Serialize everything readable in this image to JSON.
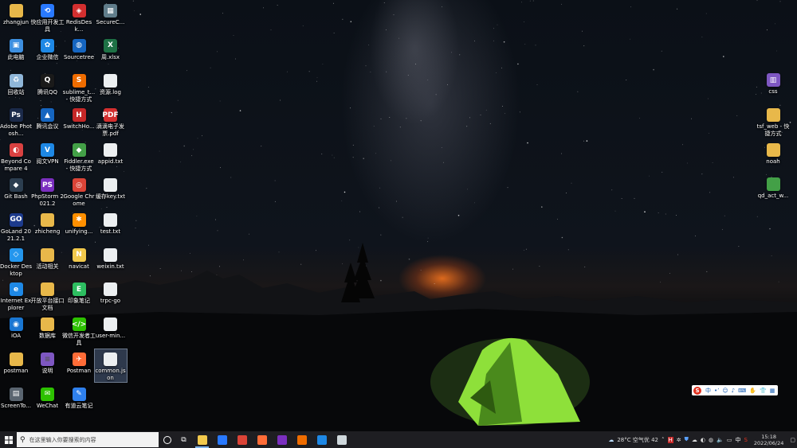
{
  "desktop_icons": [
    {
      "label": "zhangjun",
      "icon": "folder-icon",
      "color": "#e8b84a",
      "glyph": ""
    },
    {
      "label": "此电脑",
      "icon": "computer-icon",
      "color": "#3d8fe0",
      "glyph": "▣"
    },
    {
      "label": "回收站",
      "icon": "recycle-bin-icon",
      "color": "#8fb6d8",
      "glyph": "♻"
    },
    {
      "label": "Adobe Photosh...",
      "icon": "photoshop-icon",
      "color": "#1b2a4a",
      "glyph": "Ps"
    },
    {
      "label": "Beyond Compare 4",
      "icon": "beyond-compare-icon",
      "color": "#d94141",
      "glyph": "◐"
    },
    {
      "label": "Git Bash",
      "icon": "git-bash-icon",
      "color": "#2c3e50",
      "glyph": "◆"
    },
    {
      "label": "GoLand 2021.2.1",
      "icon": "goland-icon",
      "color": "#1c3a8c",
      "glyph": "GO"
    },
    {
      "label": "Docker Desktop",
      "icon": "docker-icon",
      "color": "#2496ed",
      "glyph": "◇"
    },
    {
      "label": "Internet Explorer",
      "icon": "internet-explorer-icon",
      "color": "#1e88e5",
      "glyph": "e"
    },
    {
      "label": "iOA",
      "icon": "ioa-icon",
      "color": "#1976d2",
      "glyph": "◉"
    },
    {
      "label": "postman",
      "icon": "folder-icon",
      "color": "#e8b84a",
      "glyph": ""
    },
    {
      "label": "ScreenTo...",
      "icon": "screen-to-gif-icon",
      "color": "#5a6570",
      "glyph": "▤"
    },
    {
      "label": "快应用开发工具",
      "icon": "quickapp-icon",
      "color": "#2979ff",
      "glyph": "⟲"
    },
    {
      "label": "企业微信",
      "icon": "wecom-icon",
      "color": "#1e88e5",
      "glyph": "✿"
    },
    {
      "label": "腾讯QQ",
      "icon": "qq-icon",
      "color": "#1a1a1a",
      "glyph": "Q"
    },
    {
      "label": "腾讯会议",
      "icon": "tencent-meeting-icon",
      "color": "#1565c0",
      "glyph": "▲"
    },
    {
      "label": "阅文VPN",
      "icon": "vpn-icon",
      "color": "#1e88e5",
      "glyph": "V"
    },
    {
      "label": "PhpStorm 2021.2",
      "icon": "phpstorm-icon",
      "color": "#7b2fbf",
      "glyph": "PS"
    },
    {
      "label": "zhicheng",
      "icon": "folder-icon",
      "color": "#e8b84a",
      "glyph": ""
    },
    {
      "label": "活动相关",
      "icon": "folder-icon",
      "color": "#e8b84a",
      "glyph": ""
    },
    {
      "label": "开放平台接口文档",
      "icon": "folder-icon",
      "color": "#e8b84a",
      "glyph": ""
    },
    {
      "label": "数据库",
      "icon": "folder-icon",
      "color": "#e8b84a",
      "glyph": ""
    },
    {
      "label": "说明",
      "icon": "text-file-icon",
      "color": "#7e57c2",
      "glyph": "≡"
    },
    {
      "label": "WeChat",
      "icon": "wechat-icon",
      "color": "#2dc100",
      "glyph": "✉"
    },
    {
      "label": "RedisDesk...",
      "icon": "redis-icon",
      "color": "#d32f2f",
      "glyph": "◈"
    },
    {
      "label": "Sourcetree",
      "icon": "sourcetree-icon",
      "color": "#1565c0",
      "glyph": "◍"
    },
    {
      "label": "sublime_t... - 快捷方式",
      "icon": "sublime-icon",
      "color": "#ef6c00",
      "glyph": "S"
    },
    {
      "label": "SwitchHo...",
      "icon": "switchhosts-icon",
      "color": "#c62828",
      "glyph": "H"
    },
    {
      "label": "Fiddler.exe - 快捷方式",
      "icon": "fiddler-icon",
      "color": "#43a047",
      "glyph": "◆"
    },
    {
      "label": "Google Chrome",
      "icon": "chrome-icon",
      "color": "#db4437",
      "glyph": "◎"
    },
    {
      "label": "unifying...",
      "icon": "unifying-icon",
      "color": "#ff8f00",
      "glyph": "✱"
    },
    {
      "label": "navicat",
      "icon": "navicat-icon",
      "color": "#f2c94c",
      "glyph": "N"
    },
    {
      "label": "印象笔记",
      "icon": "evernote-icon",
      "color": "#2dbe60",
      "glyph": "E"
    },
    {
      "label": "微信开发者工具",
      "icon": "wechat-devtools-icon",
      "color": "#2dc100",
      "glyph": "</>"
    },
    {
      "label": "Postman",
      "icon": "postman-icon",
      "color": "#ff6c37",
      "glyph": "✈"
    },
    {
      "label": "有道云笔记",
      "icon": "youdao-note-icon",
      "color": "#2f80ed",
      "glyph": "✎"
    },
    {
      "label": "SecureC...",
      "icon": "securecrt-icon",
      "color": "#607d8b",
      "glyph": "▦"
    },
    {
      "label": "周.xlsx",
      "icon": "excel-icon",
      "color": "#1e7145",
      "glyph": "X"
    },
    {
      "label": "资源.log",
      "icon": "text-file-icon",
      "color": "#eceff1",
      "glyph": ""
    },
    {
      "label": "滴滴电子发票.pdf",
      "icon": "pdf-icon",
      "color": "#d32f2f",
      "glyph": "PDF"
    },
    {
      "label": "appid.txt",
      "icon": "text-file-icon",
      "color": "#eceff1",
      "glyph": ""
    },
    {
      "label": "缓存key.txt",
      "icon": "text-file-icon",
      "color": "#eceff1",
      "glyph": ""
    },
    {
      "label": "test.txt",
      "icon": "text-file-icon",
      "color": "#eceff1",
      "glyph": ""
    },
    {
      "label": "weixin.txt",
      "icon": "text-file-icon",
      "color": "#eceff1",
      "glyph": ""
    },
    {
      "label": "trpc-go",
      "icon": "file-icon",
      "color": "#eceff1",
      "glyph": ""
    },
    {
      "label": "user-min...",
      "icon": "file-icon",
      "color": "#eceff1",
      "glyph": ""
    },
    {
      "label": "common.json",
      "icon": "file-icon",
      "color": "#eceff1",
      "glyph": ""
    }
  ],
  "right_icons": [
    {
      "label": "css",
      "icon": "archive-icon",
      "color": "#7e57c2",
      "glyph": "▥"
    },
    {
      "label": "tsf_web - 快捷方式",
      "icon": "folder-shortcut-icon",
      "color": "#e8b84a",
      "glyph": ""
    },
    {
      "label": "noah",
      "icon": "folder-icon",
      "color": "#e8b84a",
      "glyph": ""
    },
    {
      "label": "qd_act_w...",
      "icon": "folder-shortcut-icon",
      "color": "#43a047",
      "glyph": ""
    }
  ],
  "taskbar": {
    "search_placeholder": "在这里输入你要搜索的内容",
    "apps": [
      {
        "name": "file-explorer",
        "color": "#f2c94c",
        "active": true
      },
      {
        "name": "quickapp",
        "color": "#2979ff",
        "active": false
      },
      {
        "name": "chrome",
        "color": "#db4437",
        "active": false
      },
      {
        "name": "postman",
        "color": "#ff6c37",
        "active": false
      },
      {
        "name": "phpstorm",
        "color": "#7b2fbf",
        "active": false
      },
      {
        "name": "sublime",
        "color": "#ef6c00",
        "active": false
      },
      {
        "name": "feishu",
        "color": "#1e88e5",
        "active": false
      },
      {
        "name": "terminal",
        "color": "#cfd8dc",
        "active": false
      }
    ],
    "weather": "28°C 空气优 42",
    "time": "15:18",
    "date": "2022/06/24"
  },
  "ime_toolbar": {
    "mode": "中"
  }
}
